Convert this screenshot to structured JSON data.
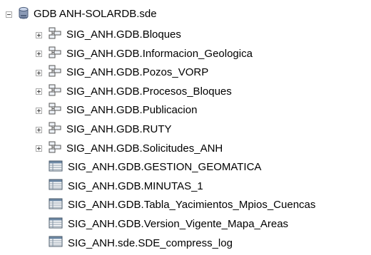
{
  "root": {
    "label": "GDB ANH-SOLARDB.sde",
    "icon": "database-icon",
    "expanded": true
  },
  "items": [
    {
      "label": "SIG_ANH.GDB.Bloques",
      "icon": "feature-dataset-icon",
      "expandable": true
    },
    {
      "label": "SIG_ANH.GDB.Informacion_Geologica",
      "icon": "feature-dataset-icon",
      "expandable": true
    },
    {
      "label": "SIG_ANH.GDB.Pozos_VORP",
      "icon": "feature-dataset-icon",
      "expandable": true
    },
    {
      "label": "SIG_ANH.GDB.Procesos_Bloques",
      "icon": "feature-dataset-icon",
      "expandable": true
    },
    {
      "label": "SIG_ANH.GDB.Publicacion",
      "icon": "feature-dataset-icon",
      "expandable": true
    },
    {
      "label": "SIG_ANH.GDB.RUTY",
      "icon": "feature-dataset-icon",
      "expandable": true
    },
    {
      "label": "SIG_ANH.GDB.Solicitudes_ANH",
      "icon": "feature-dataset-icon",
      "expandable": true
    },
    {
      "label": "SIG_ANH.GDB.GESTION_GEOMATICA",
      "icon": "table-icon",
      "expandable": false
    },
    {
      "label": "SIG_ANH.GDB.MINUTAS_1",
      "icon": "table-icon",
      "expandable": false
    },
    {
      "label": "SIG_ANH.GDB.Tabla_Yacimientos_Mpios_Cuencas",
      "icon": "table-icon",
      "expandable": false
    },
    {
      "label": "SIG_ANH.GDB.Version_Vigente_Mapa_Areas",
      "icon": "table-icon",
      "expandable": false
    },
    {
      "label": "SIG_ANH.sde.SDE_compress_log",
      "icon": "table-icon",
      "expandable": false
    }
  ]
}
